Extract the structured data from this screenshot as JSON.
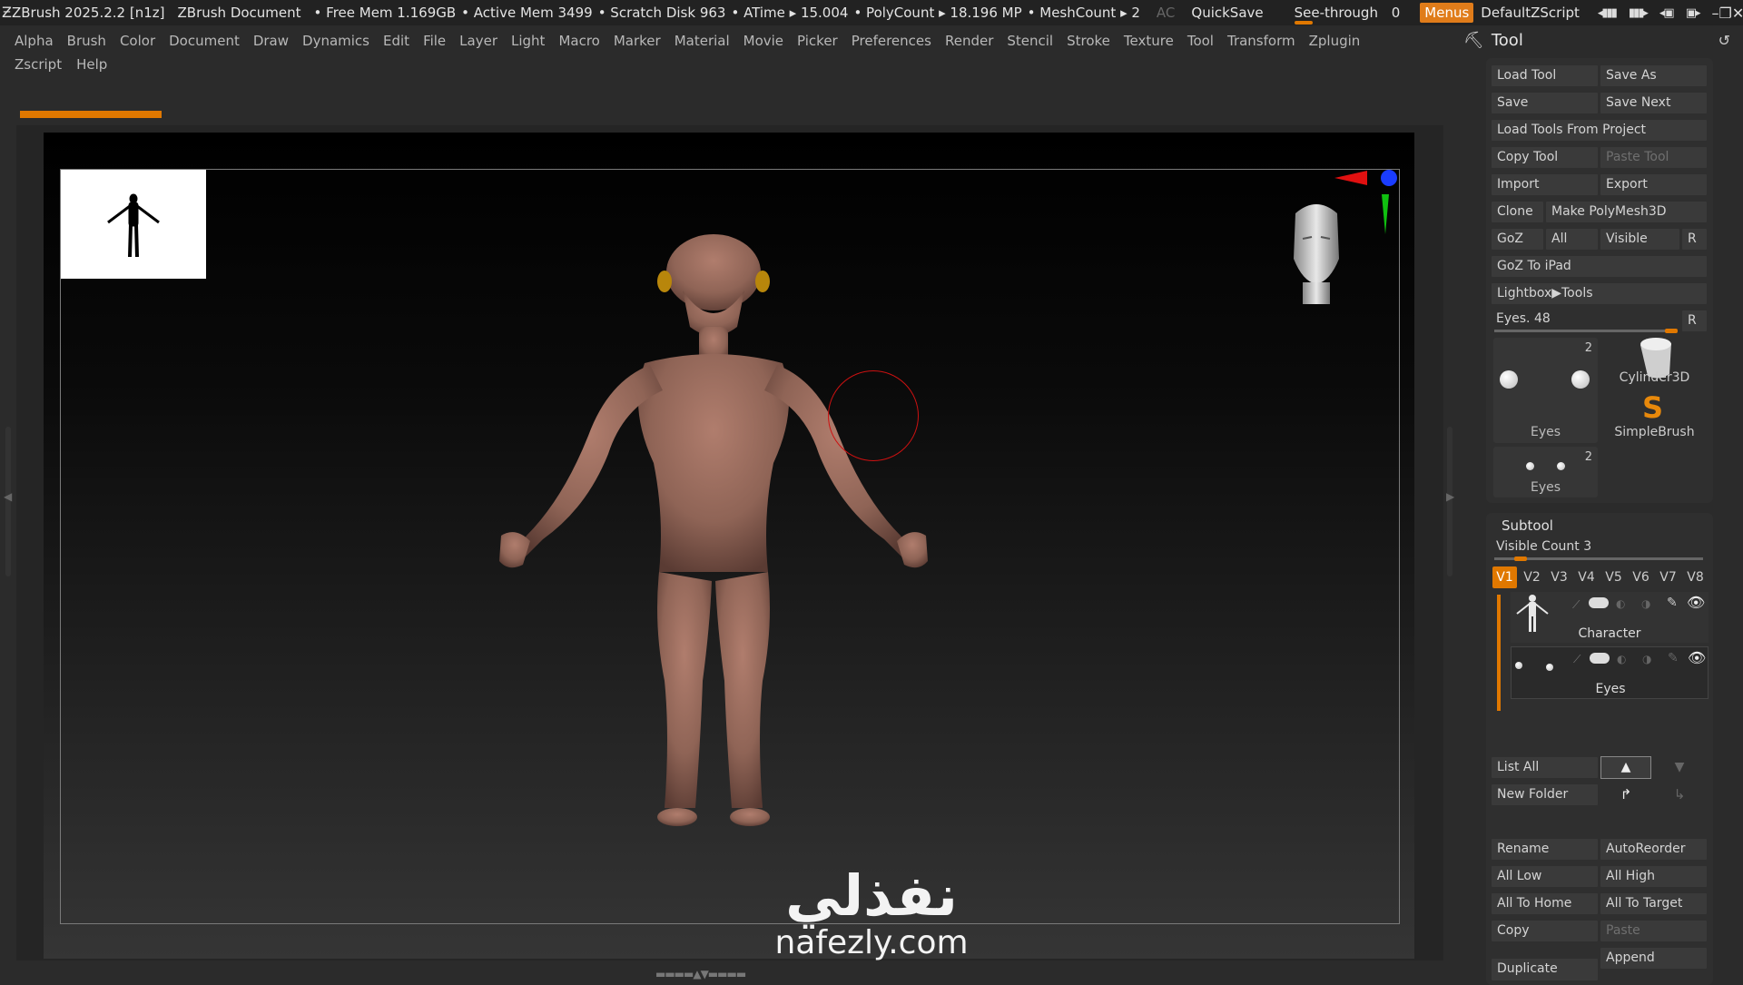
{
  "titlebar": {
    "app": "ZBrush 2025.2.2 [n1z]",
    "document": "ZBrush Document",
    "free_mem": "• Free Mem 1.169GB",
    "active_mem": "• Active Mem 3499",
    "scratch": "• Scratch Disk 963",
    "atime": "• ATime ▸ 15.004",
    "polycount": "• PolyCount ▸ 18.196 MP",
    "meshcount": "• MeshCount ▸ 2",
    "ac": "AC",
    "quicksave": "QuickSave",
    "see_through": "See-through",
    "see_through_value": "0",
    "menus": "Menus",
    "script": "DefaultZScript"
  },
  "menu": {
    "row1": [
      "Alpha",
      "Brush",
      "Color",
      "Document",
      "Draw",
      "Dynamics",
      "Edit",
      "File",
      "Layer",
      "Light",
      "Macro",
      "Marker",
      "Material",
      "Movie",
      "Picker",
      "Preferences",
      "Render",
      "Stencil",
      "Stroke",
      "Texture",
      "Tool",
      "Transform",
      "Zplugin"
    ],
    "row2": [
      "Zscript",
      "Help"
    ]
  },
  "tool_panel": {
    "title": "Tool",
    "buttons": {
      "load_tool": "Load Tool",
      "save_as": "Save As",
      "save": "Save",
      "save_next": "Save Next",
      "load_tools_from_project": "Load Tools From Project",
      "copy_tool": "Copy Tool",
      "paste_tool": "Paste Tool",
      "import": "Import",
      "export": "Export",
      "clone": "Clone",
      "make_polymesh": "Make PolyMesh3D",
      "goz": "GoZ",
      "all": "All",
      "visible": "Visible",
      "r": "R",
      "goz_to_ipad": "GoZ To iPad",
      "lightbox_tools": "Lightbox▶Tools"
    },
    "current_tool": {
      "label": "Eyes. 48",
      "r": "R"
    },
    "thumbnails": {
      "eyes_main": {
        "label": "Eyes",
        "count": "2"
      },
      "cylinder": {
        "label": "Cylinder3D"
      },
      "simplebrush": {
        "label": "SimpleBrush"
      },
      "eyes_small": {
        "label": "Eyes",
        "count": "2"
      }
    }
  },
  "subtool": {
    "title": "Subtool",
    "visible_count": "Visible Count 3",
    "visible_count_level": 0.1,
    "versions": [
      "V1",
      "V2",
      "V3",
      "V4",
      "V5",
      "V6",
      "V7",
      "V8"
    ],
    "active_version": "V1",
    "items": [
      {
        "name": "Character"
      },
      {
        "name": "Eyes"
      }
    ],
    "buttons": {
      "list_all": "List All",
      "new_folder": "New Folder",
      "rename": "Rename",
      "autoreorder": "AutoReorder",
      "all_low": "All Low",
      "all_high": "All High",
      "all_to_home": "All To Home",
      "all_to_target": "All To Target",
      "copy": "Copy",
      "paste": "Paste",
      "duplicate": "Duplicate",
      "append": "Append"
    }
  },
  "watermark": {
    "arabic": "نفذلي",
    "latin": "nafezly.com"
  },
  "colors": {
    "accent": "#e07800",
    "background": "#2b2b2b",
    "skin": "#9a6c5e"
  },
  "icons": [
    "zbrush-logo-icon",
    "tool-icon",
    "reset-icon",
    "arrow-up-icon",
    "arrow-down-icon",
    "folder-arrow-icon",
    "eye-icon",
    "brush-icon",
    "navigation-head-icon",
    "axis-gizmo-icon"
  ]
}
